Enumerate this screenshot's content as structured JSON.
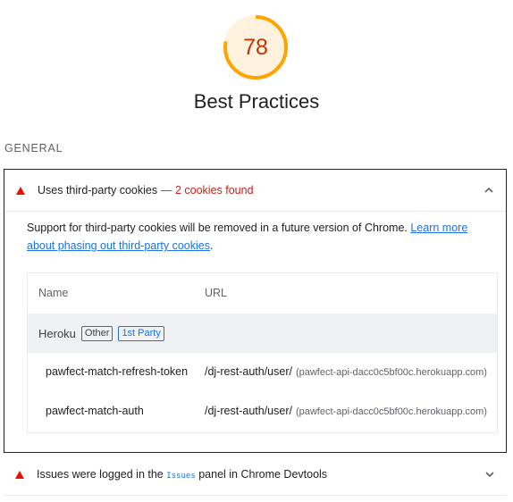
{
  "gauge": {
    "score": "78",
    "score_fraction": 0.78,
    "color": "#ffa400",
    "track_color": "#fff3e0"
  },
  "category_title": "Best Practices",
  "group_title": "GENERAL",
  "audit": {
    "title": "Uses third-party cookies",
    "display_value": "— 2 cookies found",
    "description_text": "Support for third-party cookies will be removed in a future version of Chrome. ",
    "description_link": "Learn more about phasing out third-party cookies",
    "description_end": ".",
    "table": {
      "headers": {
        "name": "Name",
        "url": "URL"
      },
      "entity": {
        "name": "Heroku",
        "chip_other": "Other",
        "chip_first_party": "1st Party"
      },
      "rows": [
        {
          "name": "pawfect-match-refresh-token",
          "url": "/dj-rest-auth/user/",
          "origin": "(pawfect-api-dacc0c5bf00c.herokuapp.com)"
        },
        {
          "name": "pawfect-match-auth",
          "url": "/dj-rest-auth/user/",
          "origin": "(pawfect-api-dacc0c5bf00c.herokuapp.com)"
        }
      ]
    }
  },
  "audit2": {
    "title_before": "Issues were logged in the ",
    "title_code": "Issues",
    "title_after": " panel in Chrome Devtools"
  },
  "colors": {
    "fail": "#eb0f00",
    "score_text": "#c33300",
    "link": "#1a73e8"
  }
}
